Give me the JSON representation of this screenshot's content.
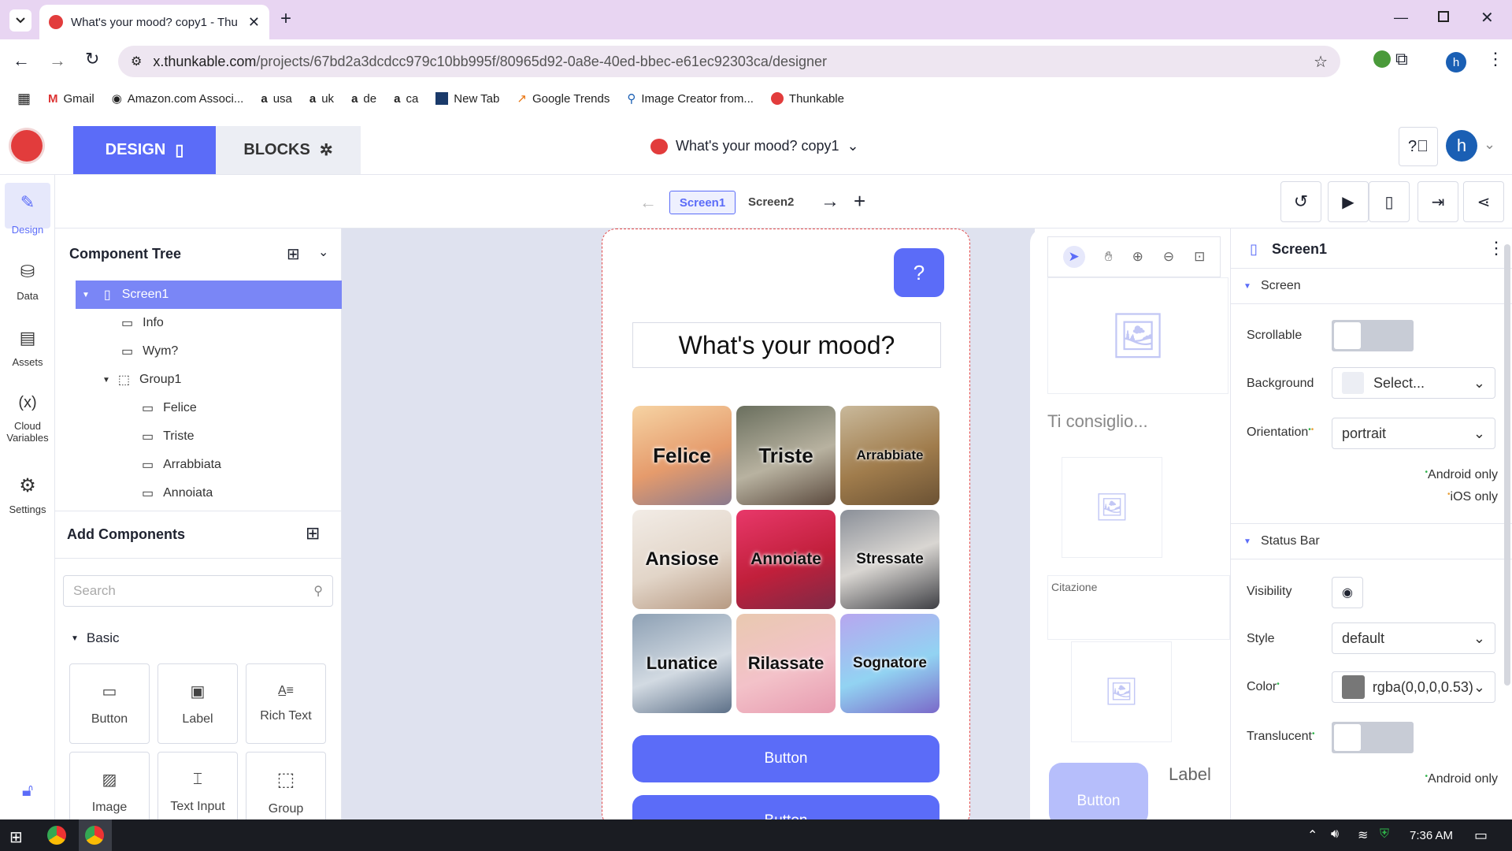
{
  "browser": {
    "tab_title": "What's your mood? copy1 - Thu",
    "url_host": "x.thunkable.com",
    "url_path": "/projects/67bd2a3dcdcc979c10bb995f/80965d92-0a8e-40ed-bbec-e61ec92303ca/designer",
    "profile_initial": "h",
    "bookmarks": [
      {
        "label": "Gmail",
        "icon": "gmail-icon"
      },
      {
        "label": "Amazon.com Associ...",
        "icon": "amazon-icon"
      },
      {
        "label": "usa",
        "icon": "amazon-a-icon"
      },
      {
        "label": "uk",
        "icon": "amazon-a-icon"
      },
      {
        "label": "de",
        "icon": "amazon-a-icon"
      },
      {
        "label": "ca",
        "icon": "amazon-a-icon"
      },
      {
        "label": "New Tab",
        "icon": "newtab-icon"
      },
      {
        "label": "Google Trends",
        "icon": "trends-icon"
      },
      {
        "label": "Image Creator from...",
        "icon": "search-icon"
      },
      {
        "label": "Thunkable",
        "icon": "thunkable-icon"
      }
    ]
  },
  "app": {
    "design_tab": "DESIGN",
    "blocks_tab": "BLOCKS",
    "project_title": "What's your mood? copy1",
    "user_initial": "h",
    "accent": "#5b6cf8"
  },
  "rail": [
    {
      "label": "Design",
      "icon": "brush-icon"
    },
    {
      "label": "Data",
      "icon": "database-icon"
    },
    {
      "label": "Assets",
      "icon": "assets-icon"
    },
    {
      "label": "Cloud Variables",
      "icon": "variable-icon"
    },
    {
      "label": "Settings",
      "icon": "gear-icon"
    }
  ],
  "screens": [
    "Screen1",
    "Screen2"
  ],
  "tree": {
    "title": "Component Tree",
    "items": [
      {
        "label": "Screen1",
        "depth": 0,
        "selected": true
      },
      {
        "label": "Info",
        "depth": 1
      },
      {
        "label": "Wym?",
        "depth": 1
      },
      {
        "label": "Group1",
        "depth": 1
      },
      {
        "label": "Felice",
        "depth": 2
      },
      {
        "label": "Triste",
        "depth": 2
      },
      {
        "label": "Arrabbiata",
        "depth": 2
      },
      {
        "label": "Annoiata",
        "depth": 2
      }
    ]
  },
  "add_components": {
    "title": "Add Components",
    "search_placeholder": "Search",
    "section": "Basic",
    "items": [
      "Button",
      "Label",
      "Rich Text",
      "Image",
      "Text Input",
      "Group"
    ]
  },
  "phone": {
    "help_label": "?",
    "heading": "What's your mood?",
    "tiles": [
      "Felice",
      "Triste",
      "Arrabbiate",
      "Ansiose",
      "Annoiate",
      "Stressate",
      "Lunatice",
      "Rilassate",
      "Sognatore"
    ],
    "buttons": [
      "Button",
      "Button"
    ]
  },
  "phone2": {
    "text1": "Ti consiglio...",
    "text2": "Citazione",
    "button": "Button",
    "label": "Label"
  },
  "props": {
    "title": "Screen1",
    "screen_section": "Screen",
    "scrollable": "Scrollable",
    "background": "Background",
    "background_value": "Select...",
    "orientation": "Orientation",
    "orientation_value": "portrait",
    "android_only": "Android only",
    "ios_only": "iOS only",
    "statusbar_section": "Status Bar",
    "visibility": "Visibility",
    "style": "Style",
    "style_value": "default",
    "color": "Color",
    "color_value": "rgba(0,0,0,0.53)",
    "translucent": "Translucent",
    "android_only_2": "Android only"
  },
  "taskbar": {
    "time": "7:36 AM"
  }
}
